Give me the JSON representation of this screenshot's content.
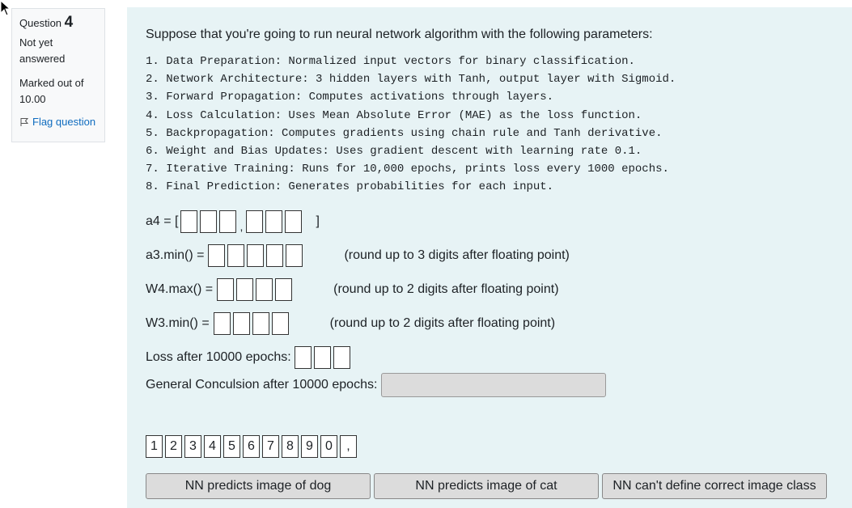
{
  "info": {
    "question_label": "Question",
    "question_number": "4",
    "state": "Not yet answered",
    "grade": "Marked out of 10.00",
    "flag_label": "Flag question"
  },
  "question": {
    "text": "Suppose that you're going to run neural network algorithm with the following parameters:",
    "steps": [
      "1. Data Preparation: Normalized input vectors for binary classification.",
      "2. Network Architecture: 3 hidden layers with Tanh, output layer with Sigmoid.",
      "3. Forward Propagation: Computes activations through layers.",
      "4. Loss Calculation: Uses Mean Absolute Error (MAE) as the loss function.",
      "5. Backpropagation: Computes gradients using chain rule and Tanh derivative.",
      "6. Weight and Bias Updates: Uses gradient descent with learning rate 0.1.",
      "7. Iterative Training: Runs for 10,000 epochs, prints loss every 1000 epochs.",
      "8. Final Prediction: Generates probabilities for each input."
    ]
  },
  "answers": {
    "a4_label": "a4 = [",
    "a4_sep": ",",
    "a4_close": "]",
    "a3_label": "a3.min() =",
    "a3_note": "(round up to  3 digits after floating point)",
    "w4_label": "W4.max() =",
    "w4_note": "(round up to  2 digits after floating point)",
    "w3_label": "W3.min() =",
    "w3_note": "(round up to  2 digits after floating point)",
    "loss_label": "Loss after 10000 epochs:",
    "concl_label": "General Conculsion after 10000 epochs:"
  },
  "tiles": [
    "1",
    "2",
    "3",
    "4",
    "5",
    "6",
    "7",
    "8",
    "9",
    "0",
    ","
  ],
  "choices": [
    "NN predicts image of dog",
    "NN predicts image of cat",
    "NN can't define correct image class"
  ]
}
